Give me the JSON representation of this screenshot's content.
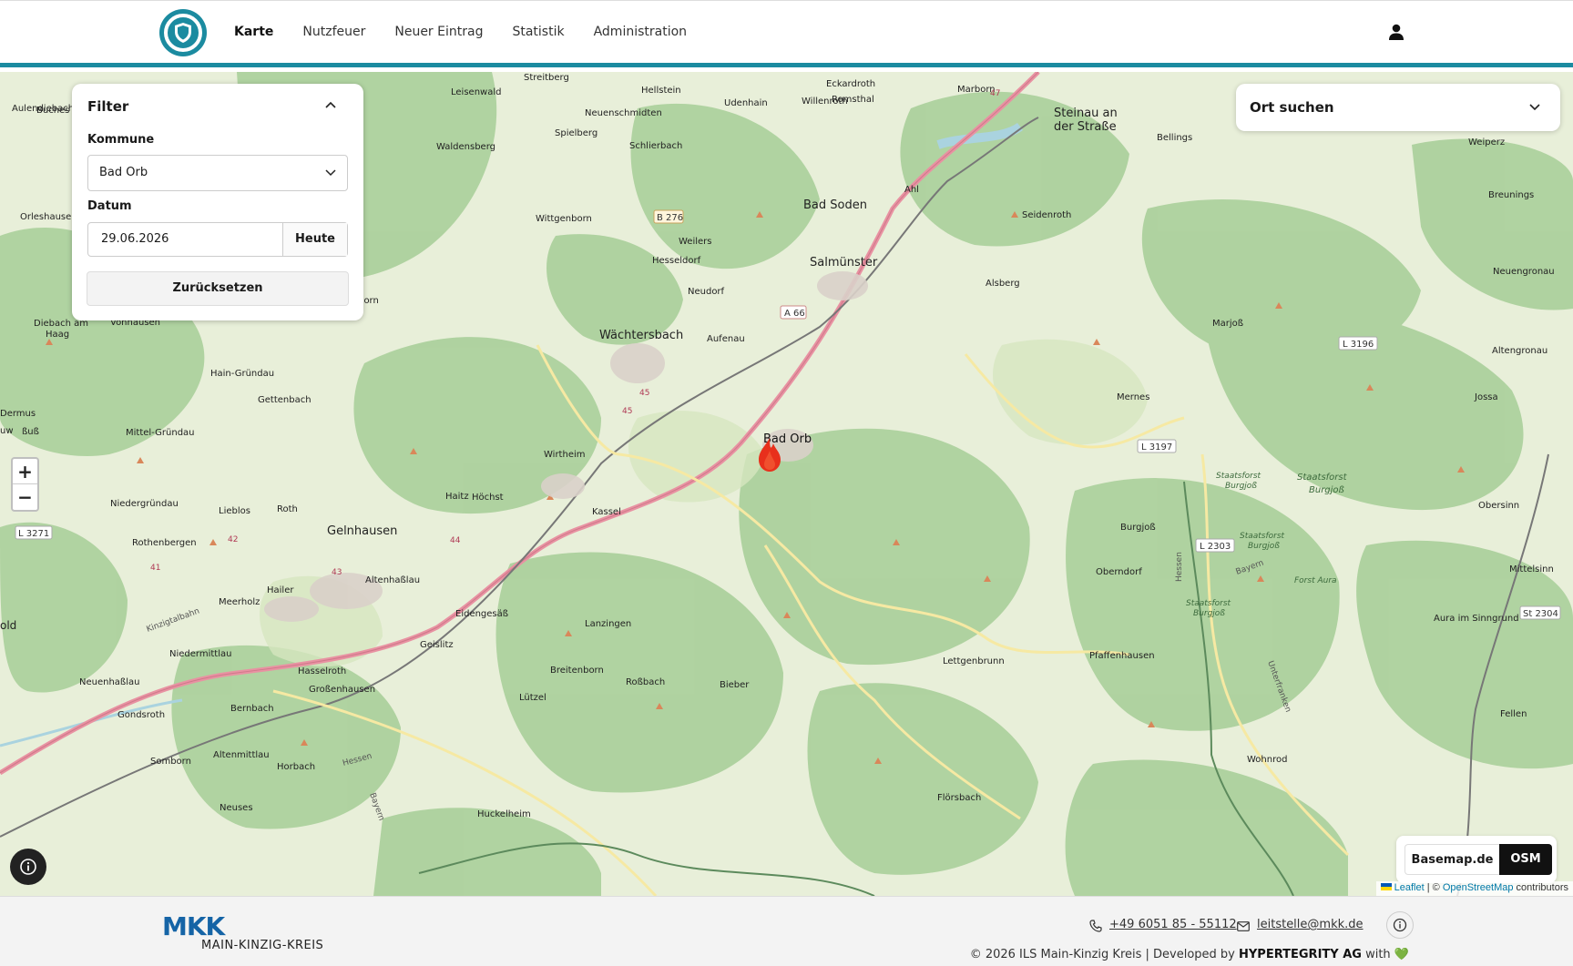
{
  "nav": {
    "items": [
      "Karte",
      "Nutzfeuer",
      "Neuer Eintrag",
      "Statistik",
      "Administration"
    ],
    "active_index": 0
  },
  "filter": {
    "title": "Filter",
    "kommune_label": "Kommune",
    "kommune_value": "Bad Orb",
    "datum_label": "Datum",
    "datum_value": "29.06.2026",
    "today_button": "Heute",
    "reset_button": "Zurücksetzen"
  },
  "search": {
    "label": "Ort suchen"
  },
  "zoom": {
    "in": "+",
    "out": "−"
  },
  "layers": {
    "basemap": "Basemap.de",
    "osm": "OSM",
    "active": "OSM"
  },
  "attribution": {
    "leaflet": "Leaflet",
    "sep": " | © ",
    "osm": "OpenStreetMap",
    "contributors": " contributors"
  },
  "map": {
    "places": [
      "Streitberg",
      "Leisenwald",
      "Hellstein",
      "Udenhain",
      "Eckardroth",
      "Willenroth",
      "Romsthal",
      "Marborn",
      "Steinau an",
      "der Straße",
      "Bellings",
      "Weiperz",
      "Breunings",
      "Neuenschmidten",
      "Spielberg",
      "Schlierbach",
      "Waldensberg",
      "Wittgenborn",
      "Bad Soden",
      "Ahl",
      "Seidenroth",
      "Neuengronau",
      "Weilers",
      "Hesseldorf",
      "Salmünster",
      "Alsberg",
      "Neudorf",
      "Wächtersbach",
      "Aufenau",
      "Marjoß",
      "Altengronau",
      "Breitenborn",
      "Vonhausen",
      "Diebach am",
      "Haag",
      "Hain-Gründau",
      "Gettenbach",
      "Mernes",
      "Jossa",
      "Bad Orb",
      "Mittel-Gründau",
      "Wirtheim",
      "Staatsforst",
      "Burgjoß",
      "Haitz",
      "Höchst",
      "Niedergründau",
      "Lieblos",
      "Roth",
      "Kassel",
      "Gelnhausen",
      "Rothenbergen",
      "Altenhaßlau",
      "Burgjoß",
      "Obersinn",
      "Oberndorf",
      "Hailer",
      "Meerholz",
      "Eidengesäß",
      "Lanzingen",
      "Geislitz",
      "Mittelsinn",
      "Aura im Sinngrund",
      "Niedermittlau",
      "Neuenhaßlau",
      "Hasselroth",
      "Großenhausen",
      "Lettgenbrunn",
      "Pfaffenhausen",
      "Lützel",
      "Roßbach",
      "Bieber",
      "Bernbach",
      "Gondsroth",
      "Somborn",
      "Altenmittlau",
      "Horbach",
      "Neuses",
      "Huckelheim",
      "Flörsbach",
      "Wohnrod",
      "Fellen",
      "Buches",
      "Aulendiebach",
      "Orleshausen",
      "Forst Aura",
      "Kinzigtalbahn",
      "Hessen",
      "Bayern",
      "Unterfranken",
      "Dermus",
      "Fuß",
      "Rold"
    ],
    "road_labels": [
      "B 276",
      "A 66",
      "L 3196",
      "L 3197",
      "L 2303",
      "L 3271",
      "St 2304",
      "47",
      "45",
      "42",
      "41",
      "43",
      "44"
    ],
    "marker": "fire-marker"
  },
  "footer": {
    "logo_big": "MKK",
    "logo_sub": "MAIN-KINZIG-KREIS",
    "phone": "+49 6051 85 - 55112",
    "email": "leitstelle@mkk.de",
    "copyright_pre": "© 2026 ILS Main-Kinzig Kreis | Developed by ",
    "developer": "HYPERTEGRITY AG",
    "copyright_post": " with ",
    "heart": "💚"
  },
  "colors": {
    "accent": "#1b8ba0",
    "forest": "#add19e",
    "field": "#e8efd9",
    "road": "#e892a2",
    "fire": "#e8301c"
  }
}
